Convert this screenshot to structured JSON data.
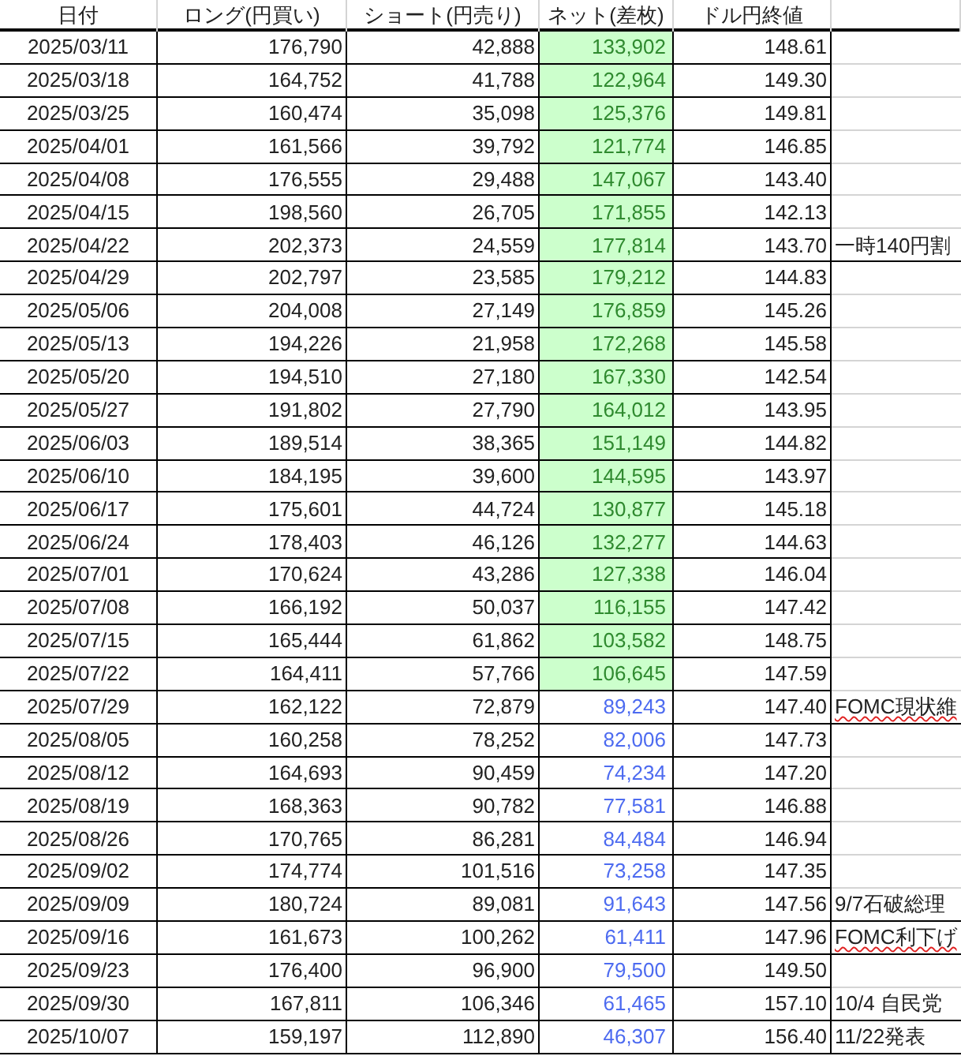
{
  "columns": [
    "日付",
    "ロング(円買い)",
    "ショート(円売り)",
    "ネット(差枚)",
    "ドル円終値"
  ],
  "rows": [
    {
      "date": "2025/03/11",
      "long": "176,790",
      "short": "42,888",
      "net": {
        "text": "133,902",
        "kind": "highlighted"
      },
      "price": "148.61"
    },
    {
      "date": "2025/03/18",
      "long": "164,752",
      "short": "41,788",
      "net": {
        "text": "122,964",
        "kind": "highlighted"
      },
      "price": "149.30"
    },
    {
      "date": "2025/03/25",
      "long": "160,474",
      "short": "35,098",
      "net": {
        "text": "125,376",
        "kind": "highlighted"
      },
      "price": "149.81"
    },
    {
      "date": "2025/04/01",
      "long": "161,566",
      "short": "39,792",
      "net": {
        "text": "121,774",
        "kind": "highlighted"
      },
      "price": "146.85"
    },
    {
      "date": "2025/04/08",
      "long": "176,555",
      "short": "29,488",
      "net": {
        "text": "147,067",
        "kind": "highlighted"
      },
      "price": "143.40"
    },
    {
      "date": "2025/04/15",
      "long": "198,560",
      "short": "26,705",
      "net": {
        "text": "171,855",
        "kind": "highlighted"
      },
      "price": "142.13"
    },
    {
      "date": "2025/04/22",
      "long": "202,373",
      "short": "24,559",
      "net": {
        "text": "177,814",
        "kind": "highlighted"
      },
      "price": "143.70",
      "note": {
        "text": "一時140円割",
        "misspelled": false
      }
    },
    {
      "date": "2025/04/29",
      "long": "202,797",
      "short": "23,585",
      "net": {
        "text": "179,212",
        "kind": "highlighted"
      },
      "price": "144.83"
    },
    {
      "date": "2025/05/06",
      "long": "204,008",
      "short": "27,149",
      "net": {
        "text": "176,859",
        "kind": "highlighted"
      },
      "price": "145.26"
    },
    {
      "date": "2025/05/13",
      "long": "194,226",
      "short": "21,958",
      "net": {
        "text": "172,268",
        "kind": "highlighted"
      },
      "price": "145.58"
    },
    {
      "date": "2025/05/20",
      "long": "194,510",
      "short": "27,180",
      "net": {
        "text": "167,330",
        "kind": "highlighted"
      },
      "price": "142.54"
    },
    {
      "date": "2025/05/27",
      "long": "191,802",
      "short": "27,790",
      "net": {
        "text": "164,012",
        "kind": "highlighted"
      },
      "price": "143.95"
    },
    {
      "date": "2025/06/03",
      "long": "189,514",
      "short": "38,365",
      "net": {
        "text": "151,149",
        "kind": "highlighted"
      },
      "price": "144.82"
    },
    {
      "date": "2025/06/10",
      "long": "184,195",
      "short": "39,600",
      "net": {
        "text": "144,595",
        "kind": "highlighted"
      },
      "price": "143.97"
    },
    {
      "date": "2025/06/17",
      "long": "175,601",
      "short": "44,724",
      "net": {
        "text": "130,877",
        "kind": "highlighted"
      },
      "price": "145.18"
    },
    {
      "date": "2025/06/24",
      "long": "178,403",
      "short": "46,126",
      "net": {
        "text": "132,277",
        "kind": "highlighted"
      },
      "price": "144.63"
    },
    {
      "date": "2025/07/01",
      "long": "170,624",
      "short": "43,286",
      "net": {
        "text": "127,338",
        "kind": "highlighted"
      },
      "price": "146.04"
    },
    {
      "date": "2025/07/08",
      "long": "166,192",
      "short": "50,037",
      "net": {
        "text": "116,155",
        "kind": "highlighted"
      },
      "price": "147.42"
    },
    {
      "date": "2025/07/15",
      "long": "165,444",
      "short": "61,862",
      "net": {
        "text": "103,582",
        "kind": "highlighted"
      },
      "price": "148.75"
    },
    {
      "date": "2025/07/22",
      "long": "164,411",
      "short": "57,766",
      "net": {
        "text": "106,645",
        "kind": "highlighted"
      },
      "price": "147.59"
    },
    {
      "date": "2025/07/29",
      "long": "162,122",
      "short": "72,879",
      "net": {
        "text": "89,243",
        "kind": "plain"
      },
      "price": "147.40",
      "note": {
        "text": "FOMC現状維",
        "misspelled": true
      }
    },
    {
      "date": "2025/08/05",
      "long": "160,258",
      "short": "78,252",
      "net": {
        "text": "82,006",
        "kind": "plain"
      },
      "price": "147.73"
    },
    {
      "date": "2025/08/12",
      "long": "164,693",
      "short": "90,459",
      "net": {
        "text": "74,234",
        "kind": "plain"
      },
      "price": "147.20"
    },
    {
      "date": "2025/08/19",
      "long": "168,363",
      "short": "90,782",
      "net": {
        "text": "77,581",
        "kind": "plain"
      },
      "price": "146.88"
    },
    {
      "date": "2025/08/26",
      "long": "170,765",
      "short": "86,281",
      "net": {
        "text": "84,484",
        "kind": "plain"
      },
      "price": "146.94"
    },
    {
      "date": "2025/09/02",
      "long": "174,774",
      "short": "101,516",
      "net": {
        "text": "73,258",
        "kind": "plain"
      },
      "price": "147.35"
    },
    {
      "date": "2025/09/09",
      "long": "180,724",
      "short": "89,081",
      "net": {
        "text": "91,643",
        "kind": "plain"
      },
      "price": "147.56",
      "note": {
        "text": "9/7石破総理",
        "misspelled": false
      }
    },
    {
      "date": "2025/09/16",
      "long": "161,673",
      "short": "100,262",
      "net": {
        "text": "61,411",
        "kind": "plain"
      },
      "price": "147.96",
      "note": {
        "text": "FOMC利下げ",
        "misspelled": true
      }
    },
    {
      "date": "2025/09/23",
      "long": "176,400",
      "short": "96,900",
      "net": {
        "text": "79,500",
        "kind": "plain"
      },
      "price": "149.50"
    },
    {
      "date": "2025/09/30",
      "long": "167,811",
      "short": "106,346",
      "net": {
        "text": "61,465",
        "kind": "plain"
      },
      "price": "157.10",
      "note": {
        "text": "10/4 自民党",
        "misspelled": false
      }
    },
    {
      "date": "2025/10/07",
      "long": "159,197",
      "short": "112,890",
      "net": {
        "text": "46,307",
        "kind": "plain"
      },
      "price": "156.40",
      "note": {
        "text": "11/22発表",
        "misspelled": false
      }
    }
  ]
}
